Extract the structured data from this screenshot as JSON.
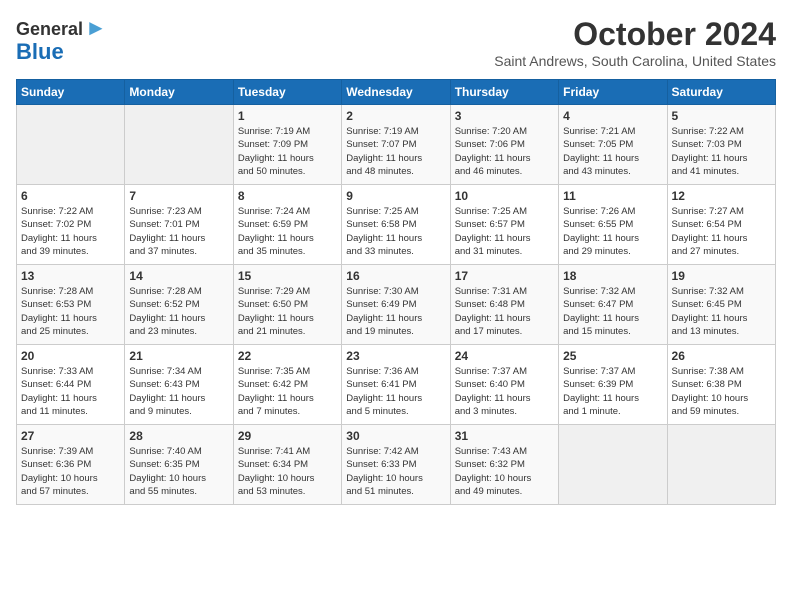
{
  "header": {
    "logo_line1": "General",
    "logo_line2": "Blue",
    "month": "October 2024",
    "location": "Saint Andrews, South Carolina, United States"
  },
  "days_of_week": [
    "Sunday",
    "Monday",
    "Tuesday",
    "Wednesday",
    "Thursday",
    "Friday",
    "Saturday"
  ],
  "weeks": [
    [
      {
        "day": "",
        "info": ""
      },
      {
        "day": "",
        "info": ""
      },
      {
        "day": "1",
        "info": "Sunrise: 7:19 AM\nSunset: 7:09 PM\nDaylight: 11 hours\nand 50 minutes."
      },
      {
        "day": "2",
        "info": "Sunrise: 7:19 AM\nSunset: 7:07 PM\nDaylight: 11 hours\nand 48 minutes."
      },
      {
        "day": "3",
        "info": "Sunrise: 7:20 AM\nSunset: 7:06 PM\nDaylight: 11 hours\nand 46 minutes."
      },
      {
        "day": "4",
        "info": "Sunrise: 7:21 AM\nSunset: 7:05 PM\nDaylight: 11 hours\nand 43 minutes."
      },
      {
        "day": "5",
        "info": "Sunrise: 7:22 AM\nSunset: 7:03 PM\nDaylight: 11 hours\nand 41 minutes."
      }
    ],
    [
      {
        "day": "6",
        "info": "Sunrise: 7:22 AM\nSunset: 7:02 PM\nDaylight: 11 hours\nand 39 minutes."
      },
      {
        "day": "7",
        "info": "Sunrise: 7:23 AM\nSunset: 7:01 PM\nDaylight: 11 hours\nand 37 minutes."
      },
      {
        "day": "8",
        "info": "Sunrise: 7:24 AM\nSunset: 6:59 PM\nDaylight: 11 hours\nand 35 minutes."
      },
      {
        "day": "9",
        "info": "Sunrise: 7:25 AM\nSunset: 6:58 PM\nDaylight: 11 hours\nand 33 minutes."
      },
      {
        "day": "10",
        "info": "Sunrise: 7:25 AM\nSunset: 6:57 PM\nDaylight: 11 hours\nand 31 minutes."
      },
      {
        "day": "11",
        "info": "Sunrise: 7:26 AM\nSunset: 6:55 PM\nDaylight: 11 hours\nand 29 minutes."
      },
      {
        "day": "12",
        "info": "Sunrise: 7:27 AM\nSunset: 6:54 PM\nDaylight: 11 hours\nand 27 minutes."
      }
    ],
    [
      {
        "day": "13",
        "info": "Sunrise: 7:28 AM\nSunset: 6:53 PM\nDaylight: 11 hours\nand 25 minutes."
      },
      {
        "day": "14",
        "info": "Sunrise: 7:28 AM\nSunset: 6:52 PM\nDaylight: 11 hours\nand 23 minutes."
      },
      {
        "day": "15",
        "info": "Sunrise: 7:29 AM\nSunset: 6:50 PM\nDaylight: 11 hours\nand 21 minutes."
      },
      {
        "day": "16",
        "info": "Sunrise: 7:30 AM\nSunset: 6:49 PM\nDaylight: 11 hours\nand 19 minutes."
      },
      {
        "day": "17",
        "info": "Sunrise: 7:31 AM\nSunset: 6:48 PM\nDaylight: 11 hours\nand 17 minutes."
      },
      {
        "day": "18",
        "info": "Sunrise: 7:32 AM\nSunset: 6:47 PM\nDaylight: 11 hours\nand 15 minutes."
      },
      {
        "day": "19",
        "info": "Sunrise: 7:32 AM\nSunset: 6:45 PM\nDaylight: 11 hours\nand 13 minutes."
      }
    ],
    [
      {
        "day": "20",
        "info": "Sunrise: 7:33 AM\nSunset: 6:44 PM\nDaylight: 11 hours\nand 11 minutes."
      },
      {
        "day": "21",
        "info": "Sunrise: 7:34 AM\nSunset: 6:43 PM\nDaylight: 11 hours\nand 9 minutes."
      },
      {
        "day": "22",
        "info": "Sunrise: 7:35 AM\nSunset: 6:42 PM\nDaylight: 11 hours\nand 7 minutes."
      },
      {
        "day": "23",
        "info": "Sunrise: 7:36 AM\nSunset: 6:41 PM\nDaylight: 11 hours\nand 5 minutes."
      },
      {
        "day": "24",
        "info": "Sunrise: 7:37 AM\nSunset: 6:40 PM\nDaylight: 11 hours\nand 3 minutes."
      },
      {
        "day": "25",
        "info": "Sunrise: 7:37 AM\nSunset: 6:39 PM\nDaylight: 11 hours\nand 1 minute."
      },
      {
        "day": "26",
        "info": "Sunrise: 7:38 AM\nSunset: 6:38 PM\nDaylight: 10 hours\nand 59 minutes."
      }
    ],
    [
      {
        "day": "27",
        "info": "Sunrise: 7:39 AM\nSunset: 6:36 PM\nDaylight: 10 hours\nand 57 minutes."
      },
      {
        "day": "28",
        "info": "Sunrise: 7:40 AM\nSunset: 6:35 PM\nDaylight: 10 hours\nand 55 minutes."
      },
      {
        "day": "29",
        "info": "Sunrise: 7:41 AM\nSunset: 6:34 PM\nDaylight: 10 hours\nand 53 minutes."
      },
      {
        "day": "30",
        "info": "Sunrise: 7:42 AM\nSunset: 6:33 PM\nDaylight: 10 hours\nand 51 minutes."
      },
      {
        "day": "31",
        "info": "Sunrise: 7:43 AM\nSunset: 6:32 PM\nDaylight: 10 hours\nand 49 minutes."
      },
      {
        "day": "",
        "info": ""
      },
      {
        "day": "",
        "info": ""
      }
    ]
  ]
}
